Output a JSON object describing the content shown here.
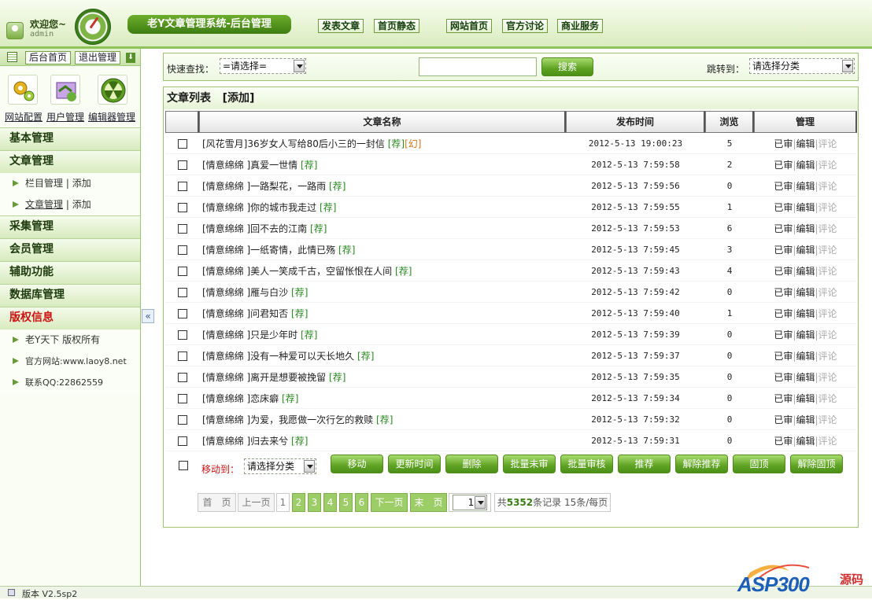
{
  "header": {
    "welcome": "欢迎您~",
    "user": "admin",
    "app_title": "老Y文章管理系统-后台管理",
    "nav": [
      "发表文章",
      "首页静态",
      "网站首页",
      "官方讨论",
      "商业服务"
    ]
  },
  "left": {
    "home_btn": "后台首页",
    "logout_btn": "退出管理",
    "icons": [
      {
        "name": "gear-icon",
        "label": "网站配置"
      },
      {
        "name": "users-icon",
        "label": "用户管理"
      },
      {
        "name": "radiation-icon",
        "label": "编辑器管理"
      }
    ],
    "sections": [
      {
        "title": "基本管理",
        "items": []
      },
      {
        "title": "文章管理",
        "items": [
          {
            "a": "栏目管理",
            "sep": "|",
            "b": "添加"
          },
          {
            "a": "文章管理",
            "sep": "|",
            "b": "添加"
          }
        ]
      },
      {
        "title": "采集管理",
        "items": []
      },
      {
        "title": "会员管理",
        "items": []
      },
      {
        "title": "辅助功能",
        "items": []
      },
      {
        "title": "数据库管理",
        "items": []
      },
      {
        "title": "版权信息",
        "items": [
          {
            "a": "老Y天下 版权所有"
          },
          {
            "a": "官方网站:www.laoy8.net"
          },
          {
            "a": "联系QQ:22862559"
          }
        ]
      }
    ],
    "collapse": "«"
  },
  "search": {
    "label": "快速查找：",
    "select": "=请选择=",
    "button": "搜索",
    "jump_label": "跳转到：",
    "jump_select": "请选择分类"
  },
  "list": {
    "title": "文章列表",
    "add": "[添加]",
    "headers": [
      "文章名称",
      "发布时间",
      "浏览",
      "管理"
    ],
    "actions": [
      "已审",
      "|",
      "编辑",
      "|",
      "评论"
    ],
    "rows": [
      {
        "title": "[风花雪月]36岁女人写给80后小三的一封信",
        "tags": [
          "[荐]",
          "[幻]"
        ],
        "time": "2012-5-13 19:00:23",
        "views": "5"
      },
      {
        "title": "[情意绵绵 ]真爱一世情",
        "tags": [
          "[荐]"
        ],
        "time": "2012-5-13 7:59:58",
        "views": "2"
      },
      {
        "title": "[情意绵绵 ]一路梨花，一路雨",
        "tags": [
          "[荐]"
        ],
        "time": "2012-5-13 7:59:56",
        "views": "0"
      },
      {
        "title": "[情意绵绵 ]你的城市我走过",
        "tags": [
          "[荐]"
        ],
        "time": "2012-5-13 7:59:55",
        "views": "1"
      },
      {
        "title": "[情意绵绵 ]回不去的江南",
        "tags": [
          "[荐]"
        ],
        "time": "2012-5-13 7:59:53",
        "views": "6"
      },
      {
        "title": "[情意绵绵 ]一纸寄情，此情已殇",
        "tags": [
          "[荐]"
        ],
        "time": "2012-5-13 7:59:45",
        "views": "3"
      },
      {
        "title": "[情意绵绵 ]美人一笑成千古，空留怅恨在人间",
        "tags": [
          "[荐]"
        ],
        "time": "2012-5-13 7:59:43",
        "views": "4"
      },
      {
        "title": "[情意绵绵 ]雁与白沙",
        "tags": [
          "[荐]"
        ],
        "time": "2012-5-13 7:59:42",
        "views": "0"
      },
      {
        "title": "[情意绵绵 ]问君知否",
        "tags": [
          "[荐]"
        ],
        "time": "2012-5-13 7:59:40",
        "views": "1"
      },
      {
        "title": "[情意绵绵 ]只是少年时",
        "tags": [
          "[荐]"
        ],
        "time": "2012-5-13 7:59:39",
        "views": "0"
      },
      {
        "title": "[情意绵绵 ]没有一种爱可以天长地久",
        "tags": [
          "[荐]"
        ],
        "time": "2012-5-13 7:59:37",
        "views": "0"
      },
      {
        "title": "[情意绵绵 ]离开是想要被挽留",
        "tags": [
          "[荐]"
        ],
        "time": "2012-5-13 7:59:35",
        "views": "0"
      },
      {
        "title": "[情意绵绵 ]恋床癖",
        "tags": [
          "[荐]"
        ],
        "time": "2012-5-13 7:59:34",
        "views": "0"
      },
      {
        "title": "[情意绵绵 ]为爱，我愿做一次行乞的救赎",
        "tags": [
          "[荐]"
        ],
        "time": "2012-5-13 7:59:32",
        "views": "0"
      },
      {
        "title": "[情意绵绵 ]归去来兮",
        "tags": [
          "[荐]"
        ],
        "time": "2012-5-13 7:59:31",
        "views": "0"
      }
    ]
  },
  "batch": {
    "move_label": "移动到：",
    "select": "请选择分类",
    "buttons": [
      "移动",
      "更新时间",
      "删除",
      "批量未审",
      "批量审核",
      "推荐",
      "解除推荐",
      "固顶",
      "解除固顶"
    ]
  },
  "pager": {
    "first": "首　页",
    "prev": "上一页",
    "pages": [
      "1",
      "2",
      "3",
      "4",
      "5",
      "6"
    ],
    "next": "下一页",
    "last": "末　页",
    "page_select": "1",
    "total_prefix": "共",
    "total": "5352",
    "total_suffix": "条记录 15条/每页"
  },
  "status": {
    "version": "版本 V2.5sp2"
  },
  "watermark": {
    "text": "ASP300",
    "suffix": "源码"
  },
  "colors": {
    "accent": "#5fa324",
    "tag": "#2a8a22",
    "red": "#cc1111"
  }
}
